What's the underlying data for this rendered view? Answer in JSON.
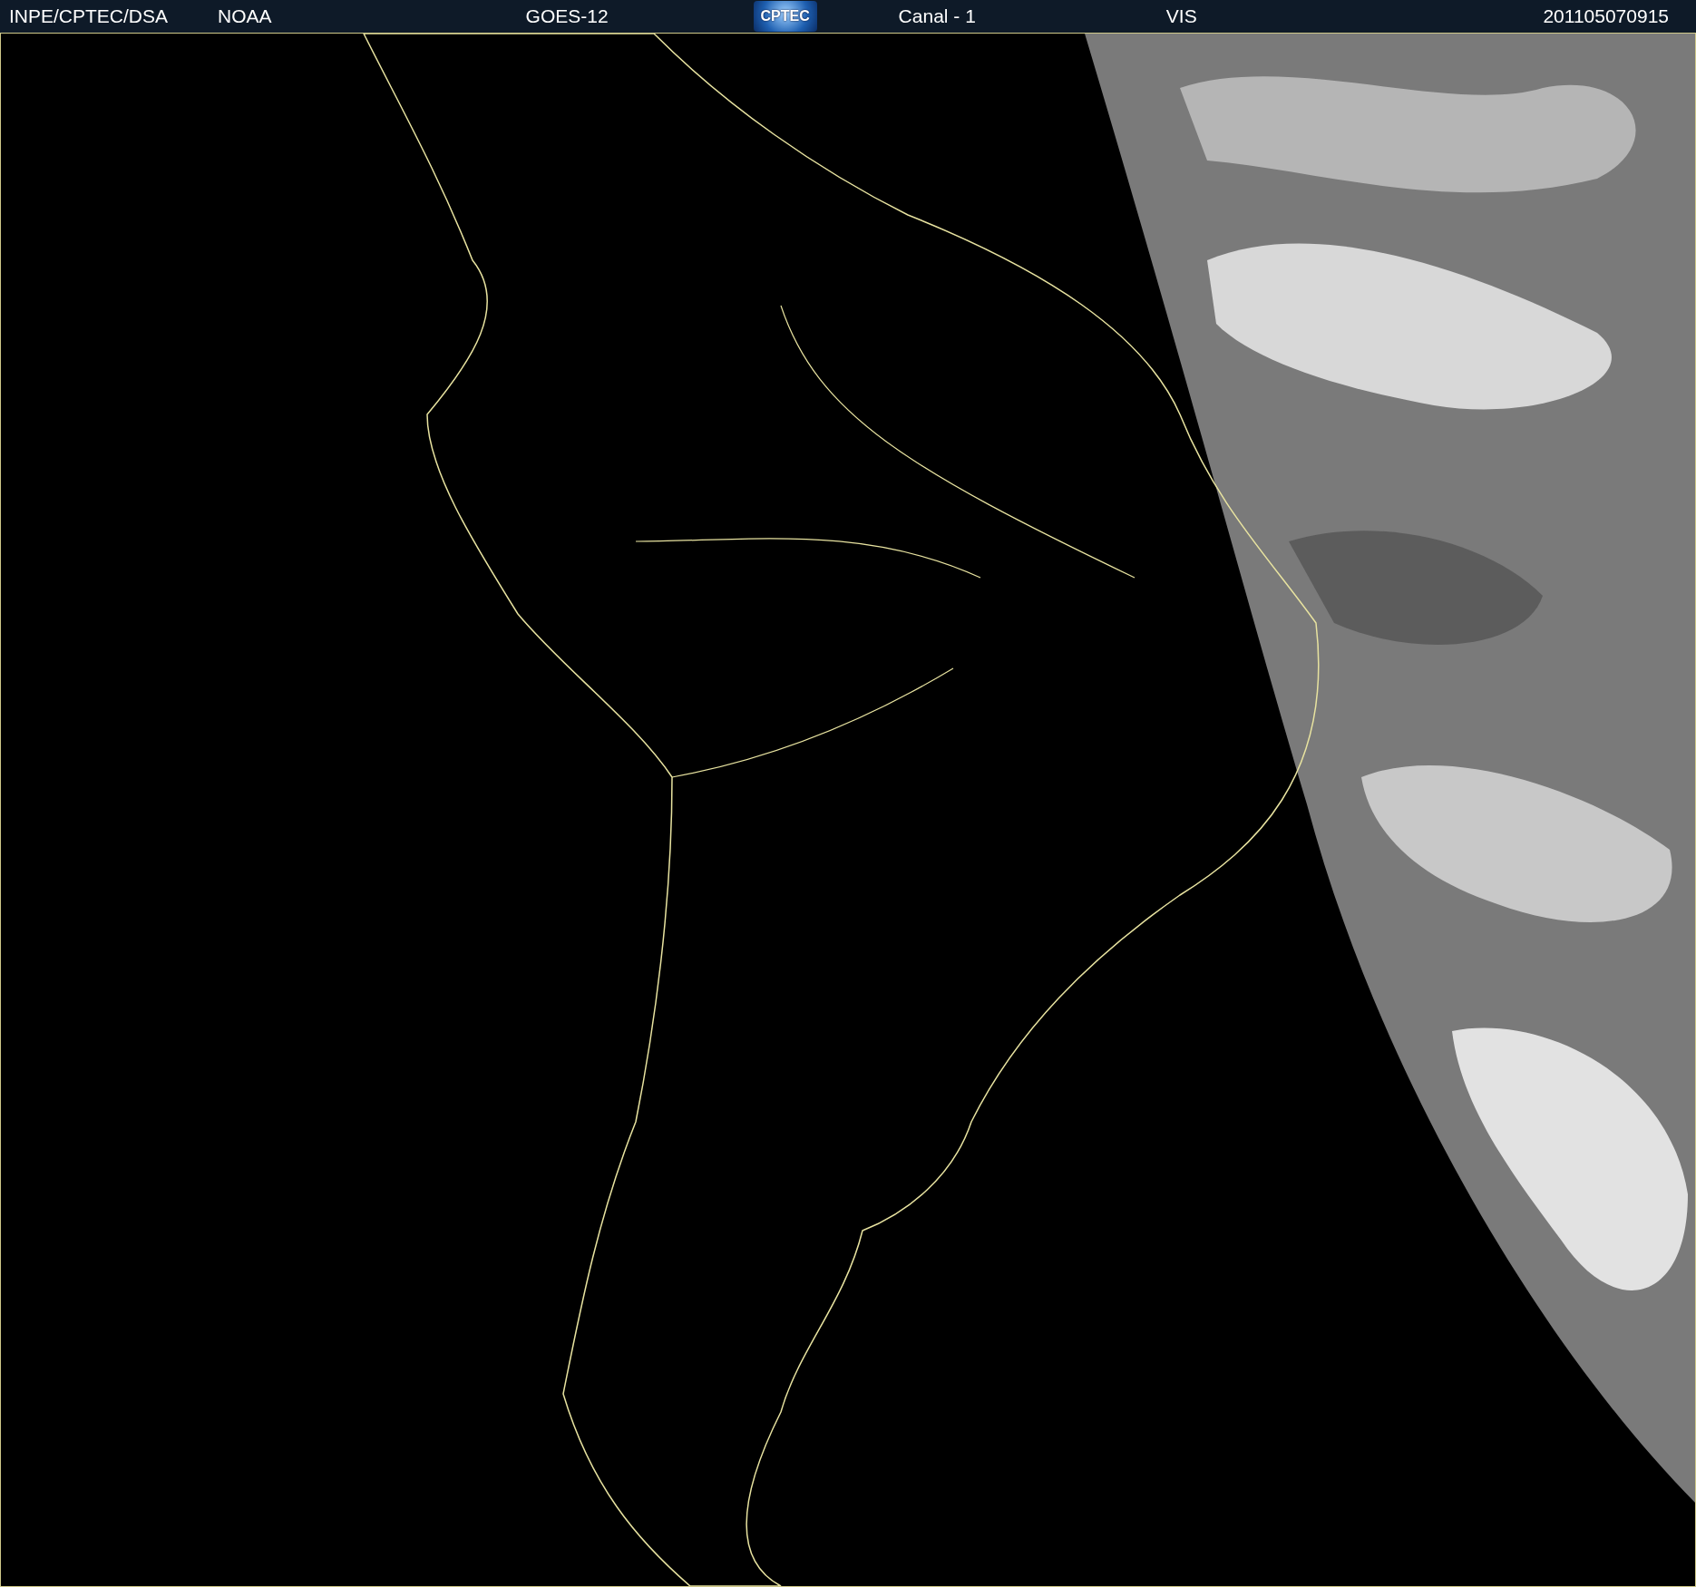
{
  "header": {
    "items": [
      {
        "kind": "text",
        "text": "INPE/CPTEC/DSA"
      },
      {
        "kind": "text",
        "text": "NOAA"
      },
      {
        "kind": "text",
        "text": "GOES-12"
      },
      {
        "kind": "logo",
        "text": "CPTEC"
      },
      {
        "kind": "text",
        "text": "Canal - 1"
      },
      {
        "kind": "text",
        "text": "VIS"
      },
      {
        "kind": "text",
        "text": "201105070915"
      }
    ]
  }
}
